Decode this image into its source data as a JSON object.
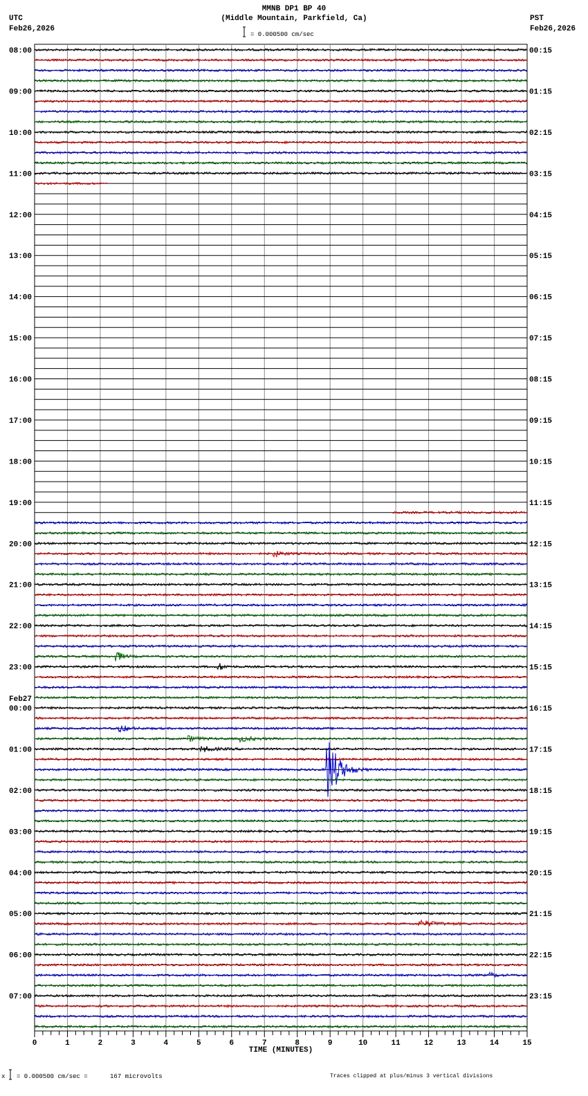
{
  "header": {
    "title": "MMNB DP1 BP 40",
    "subtitle": "(Middle Mountain, Parkfield, Ca)",
    "left_tz": "UTC",
    "left_date": "Feb26,2026",
    "right_tz": "PST",
    "right_date": "Feb26,2026",
    "scale": "= 0.000500 cm/sec"
  },
  "footer": {
    "scale": "= 0.000500 cm/sec =      167 microvolts",
    "clip_note": "Traces clipped at plus/minus 3 vertical divisions"
  },
  "chart_data": {
    "type": "line",
    "subtype": "helicorder",
    "xlabel": "TIME (MINUTES)",
    "xlim": [
      0,
      15
    ],
    "x_ticks": [
      "0",
      "1",
      "2",
      "3",
      "4",
      "5",
      "6",
      "7",
      "8",
      "9",
      "10",
      "11",
      "12",
      "13",
      "14",
      "15"
    ],
    "rows_per_hour": 4,
    "row_count": 96,
    "trace_colors": [
      "#000000",
      "#cc0000",
      "#0000cc",
      "#006600"
    ],
    "left_labels": [
      "08:00",
      "09:00",
      "10:00",
      "11:00",
      "12:00",
      "13:00",
      "14:00",
      "15:00",
      "16:00",
      "17:00",
      "18:00",
      "19:00",
      "20:00",
      "21:00",
      "22:00",
      "23:00",
      "00:00",
      "01:00",
      "02:00",
      "03:00",
      "04:00",
      "05:00",
      "06:00",
      "07:00"
    ],
    "date_change_label": "Feb27",
    "right_labels": [
      "00:15",
      "01:15",
      "02:15",
      "03:15",
      "04:15",
      "05:15",
      "06:15",
      "07:15",
      "08:15",
      "09:15",
      "10:15",
      "11:15",
      "12:15",
      "13:15",
      "14:15",
      "15:15",
      "16:15",
      "17:15",
      "18:15",
      "19:15",
      "20:15",
      "21:15",
      "22:15",
      "23:15"
    ],
    "data_gap": {
      "start_row": 13,
      "start_minute": 2.2,
      "end_row": 45,
      "end_minute": 10.9
    },
    "events": [
      {
        "row": 49,
        "minute": 7.3,
        "amplitude": 2.0,
        "duration": 0.6
      },
      {
        "row": 59,
        "minute": 2.5,
        "amplitude": 4.0,
        "duration": 0.4
      },
      {
        "row": 60,
        "minute": 5.6,
        "amplitude": 3.0,
        "duration": 0.4
      },
      {
        "row": 66,
        "minute": 2.6,
        "amplitude": 2.5,
        "duration": 0.6
      },
      {
        "row": 67,
        "minute": 4.7,
        "amplitude": 1.8,
        "duration": 0.8
      },
      {
        "row": 67,
        "minute": 6.3,
        "amplitude": 1.8,
        "duration": 0.8
      },
      {
        "row": 68,
        "minute": 5.1,
        "amplitude": 2.0,
        "duration": 0.8
      },
      {
        "row": 70,
        "minute": 8.9,
        "amplitude": 30.0,
        "duration": 0.7
      },
      {
        "row": 85,
        "minute": 11.7,
        "amplitude": 2.2,
        "duration": 1.3
      },
      {
        "row": 90,
        "minute": 13.9,
        "amplitude": 1.5,
        "duration": 0.5
      }
    ]
  }
}
